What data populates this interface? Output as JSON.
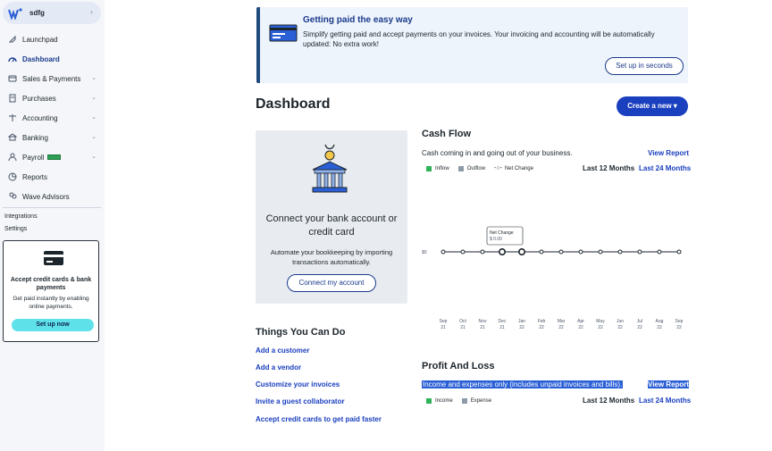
{
  "business": {
    "name": "sdfg"
  },
  "nav": [
    {
      "label": "Launchpad",
      "icon": "rocket-icon",
      "chevron": false,
      "active": false
    },
    {
      "label": "Dashboard",
      "icon": "gauge-icon",
      "chevron": false,
      "active": true
    },
    {
      "label": "Sales & Payments",
      "icon": "card-icon",
      "chevron": true,
      "active": false
    },
    {
      "label": "Purchases",
      "icon": "receipt-icon",
      "chevron": true,
      "active": false
    },
    {
      "label": "Accounting",
      "icon": "scale-icon",
      "chevron": true,
      "active": false
    },
    {
      "label": "Banking",
      "icon": "bank-icon",
      "chevron": true,
      "active": false
    },
    {
      "label": "Payroll",
      "icon": "people-icon",
      "chevron": true,
      "active": false
    },
    {
      "label": "Reports",
      "icon": "chart-icon",
      "chevron": false,
      "active": false
    },
    {
      "label": "Wave Advisors",
      "icon": "advisor-icon",
      "chevron": false,
      "active": false
    }
  ],
  "sub_links": {
    "integrations": "Integrations",
    "settings": "Settings"
  },
  "promo": {
    "title": "Accept credit cards & bank payments",
    "description": "Get paid instantly by enabling online payments.",
    "button": "Set up now"
  },
  "banner": {
    "title": "Getting paid the easy way",
    "text": "Simplify getting paid and accept payments on your invoices. Your invoicing and accounting will be automatically updated: No extra work!",
    "button": "Set up in seconds"
  },
  "page_title": "Dashboard",
  "create_button": "Create a new ▾",
  "connect_card": {
    "title": "Connect your bank account or credit card",
    "description": "Automate your bookkeeping by importing transactions automatically.",
    "button": "Connect my account"
  },
  "things": {
    "title": "Things You Can Do",
    "items": [
      "Add a customer",
      "Add a vendor",
      "Customize your invoices",
      "Invite a guest collaborator",
      "Accept credit cards to get paid faster"
    ]
  },
  "cash_flow": {
    "title": "Cash Flow",
    "subtitle": "Cash coming in and going out of your business.",
    "view_report": "View Report",
    "legend": [
      "Inflow",
      "Outflow",
      "Net Change"
    ],
    "range_12": "Last 12 Months",
    "range_24": "Last 24 Months",
    "tooltip_title": "Net Change",
    "tooltip_value": "$ 0.00",
    "y_label": "$0"
  },
  "chart_data": {
    "type": "line",
    "title": "Cash Flow",
    "x": [
      "Sep 21",
      "Oct 21",
      "Nov 21",
      "Dec 21",
      "Jan 22",
      "Feb 22",
      "Mar 22",
      "Apr 22",
      "May 22",
      "Jun 22",
      "Jul 22",
      "Aug 22",
      "Sep 22"
    ],
    "x_ticks": [
      [
        "Sep",
        "21"
      ],
      [
        "Oct",
        "21"
      ],
      [
        "Nov",
        "21"
      ],
      [
        "Dec",
        "21"
      ],
      [
        "Jan",
        "22"
      ],
      [
        "Feb",
        "22"
      ],
      [
        "Mar",
        "22"
      ],
      [
        "Apr",
        "22"
      ],
      [
        "May",
        "22"
      ],
      [
        "Jun",
        "22"
      ],
      [
        "Jul",
        "22"
      ],
      [
        "Aug",
        "22"
      ],
      [
        "Sep",
        "22"
      ]
    ],
    "series": [
      {
        "name": "Inflow",
        "values": [
          0,
          0,
          0,
          0,
          0,
          0,
          0,
          0,
          0,
          0,
          0,
          0,
          0
        ]
      },
      {
        "name": "Outflow",
        "values": [
          0,
          0,
          0,
          0,
          0,
          0,
          0,
          0,
          0,
          0,
          0,
          0,
          0
        ]
      },
      {
        "name": "Net Change",
        "values": [
          0,
          0,
          0,
          0,
          0,
          0,
          0,
          0,
          0,
          0,
          0,
          0,
          0
        ]
      }
    ],
    "highlighted_index": 3,
    "colors": {
      "inflow": "#2fb35a",
      "outflow": "#8d9aa8",
      "net": "#1c252c"
    }
  },
  "profit_loss": {
    "title": "Profit And Loss",
    "subtitle": "Income and expenses only (includes unpaid invoices and bills).",
    "view_report": "View Report",
    "legend": [
      "Income",
      "Expense"
    ],
    "range_12": "Last 12 Months",
    "range_24": "Last 24 Months"
  },
  "colors": {
    "accent": "#1a3fbf",
    "promo_button": "#5ee1e9",
    "banner_bg": "#eef4fb",
    "selection": "#2a5fd6"
  }
}
